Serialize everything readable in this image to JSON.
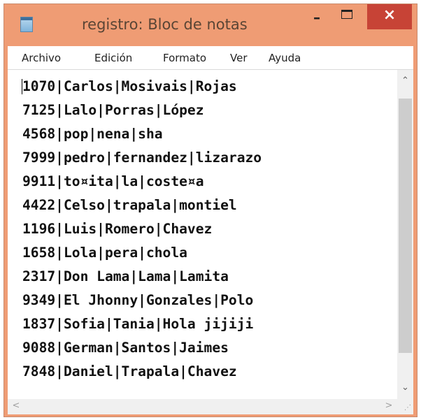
{
  "window": {
    "title": "registro: Bloc de notas",
    "minimize_symbol": "–",
    "close_symbol": "×",
    "icon": "notepad-icon"
  },
  "menu": {
    "items": [
      "Archivo",
      "Edición",
      "Formato",
      "Ver",
      "Ayuda"
    ]
  },
  "document": {
    "lines": [
      "1070|Carlos|Mosivais|Rojas",
      "7125|Lalo|Porras|López",
      "4568|pop|nena|sha",
      "7999|pedro|fernandez|lizarazo",
      "9911|to¤ita|la|coste¤a",
      "4422|Celso|trapala|montiel",
      "1196|Luis|Romero|Chavez",
      "1658|Lola|pera|chola",
      "2317|Don Lama|Lama|Lamita",
      "9349|El Jhonny|Gonzales|Polo",
      "1837|Sofia|Tania|Hola jijiji",
      "9088|German|Santos|Jaimes",
      "7848|Daniel|Trapala|Chavez"
    ]
  },
  "scrollbars": {
    "up": "⌃",
    "down": "⌄",
    "left": "<",
    "right": ">",
    "grip": "⋰"
  },
  "colors": {
    "title_bar": "#ef9c74",
    "close_button": "#c74336",
    "editor_background": "#ffffff",
    "text": "#111111"
  }
}
